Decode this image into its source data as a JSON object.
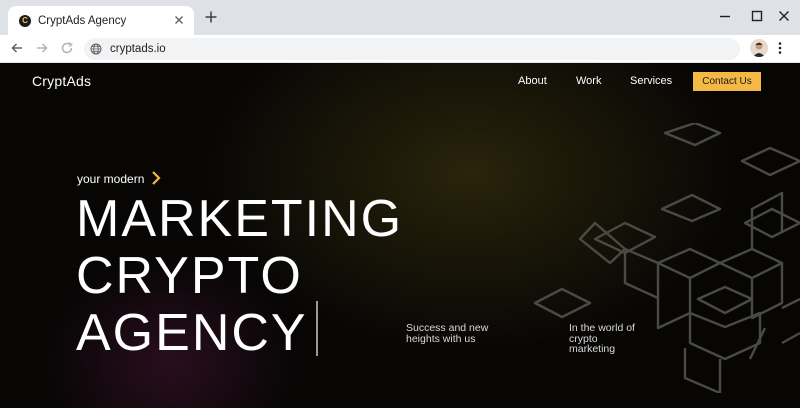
{
  "browser": {
    "tab_title": "CryptAds Agency",
    "url": "cryptads.io",
    "favicon_letter": "C"
  },
  "site": {
    "brand": "CryptAds",
    "nav": [
      "About",
      "Work",
      "Services"
    ],
    "cta": "Contact Us"
  },
  "hero": {
    "eyebrow": "your modern",
    "headline": [
      "MARKETING",
      "CRYPTO",
      "AGENCY"
    ],
    "tagline_left": "Success and new heights with us",
    "tagline_right": "In the world of crypto marketing"
  },
  "colors": {
    "accent": "#f4b945",
    "background": "#070605",
    "chrome": "#dee1e6"
  },
  "icons": [
    "close-icon",
    "plus-icon",
    "minimize-icon",
    "maximize-icon",
    "back-arrow-icon",
    "forward-arrow-icon",
    "reload-icon",
    "globe-icon",
    "menu-dots-icon",
    "chevron-right-icon"
  ]
}
